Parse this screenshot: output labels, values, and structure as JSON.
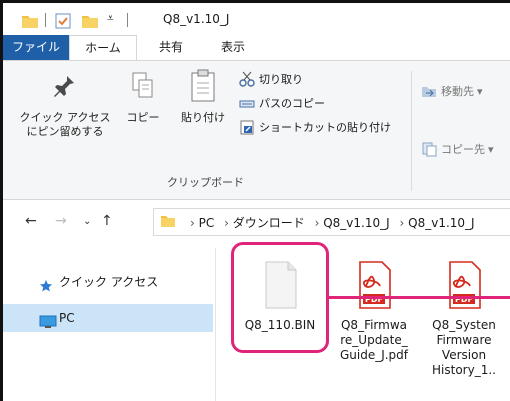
{
  "window": {
    "title": "Q8_v1.10_J"
  },
  "ribbon_tabs": [
    "ファイル",
    "ホーム",
    "共有",
    "表示"
  ],
  "ribbon": {
    "pin_label_line1": "クイック アクセス",
    "pin_label_line2": "にピン留めする",
    "copy_label": "コピー",
    "paste_label": "貼り付け",
    "cut_label": "切り取り",
    "copy_path_label": "パスのコピー",
    "paste_shortcut_label": "ショートカットの貼り付け",
    "group_clipboard": "クリップボード",
    "move_to_label": "移動先",
    "copy_to_label": "コピー先"
  },
  "address": {
    "crumbs": [
      "PC",
      "ダウンロード",
      "Q8_v1.10_J",
      "Q8_v1.10_J"
    ]
  },
  "nav": {
    "items": [
      {
        "label": "クイック アクセス",
        "icon": "star-icon",
        "selected": false
      },
      {
        "label": "PC",
        "icon": "monitor-icon",
        "selected": true
      }
    ]
  },
  "files": [
    {
      "name": "Q8_110.BIN",
      "icon": "blank-file-icon",
      "highlighted": true
    },
    {
      "name": "Q8_Firmwa\nre_Update_\nGuide_J.pdf",
      "icon": "pdf-icon",
      "highlighted": false
    },
    {
      "name": "Q8_Systen\nFirmware\nVersion\nHistory_1..",
      "icon": "pdf-icon",
      "highlighted": false
    }
  ],
  "colors": {
    "accent_file_tab": "#1f5fa8",
    "highlight": "#e0247a",
    "selection": "#cce4f7",
    "pdf_red": "#d52b1e"
  }
}
